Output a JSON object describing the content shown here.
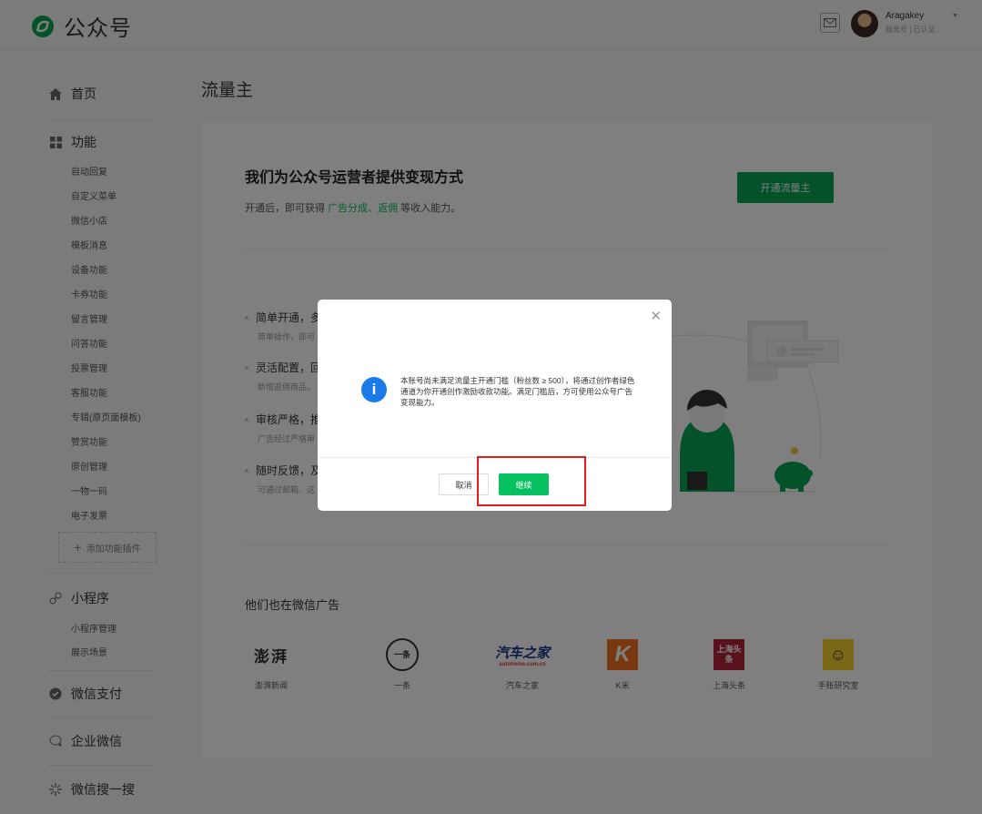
{
  "header": {
    "logo_text": "公众号",
    "user_name": "Aragakey",
    "user_sub": "服务号 | 已认证"
  },
  "sidebar": {
    "home": "首页",
    "features": "功能",
    "feature_items": [
      "自动回复",
      "自定义菜单",
      "微信小店",
      "模板消息",
      "设备功能",
      "卡券功能",
      "留言管理",
      "问答功能",
      "投票管理",
      "客服功能",
      "专辑(原页面模板)",
      "赞赏功能",
      "原创管理",
      "一物一码",
      "电子发票"
    ],
    "add_plugin": "添加功能插件",
    "miniprogram": "小程序",
    "miniprogram_items": [
      "小程序管理",
      "展示场景"
    ],
    "pay": "微信支付",
    "work": "企业微信",
    "search": "微信搜一搜"
  },
  "main": {
    "title": "流量主",
    "hero_title": "我们为公众号运营者提供变现方式",
    "hero_desc_pre": "开通后，即可获得 ",
    "hero_desc_link1": "广告分成",
    "hero_desc_sep": "、",
    "hero_desc_link2": "返佣",
    "hero_desc_post": " 等收入能力。",
    "open_button": "开通流量主",
    "features": [
      {
        "title": "简单开通，多",
        "desc": "简单操作，即可"
      },
      {
        "title": "灵活配置，回",
        "desc": "新增返佣商品，"
      },
      {
        "title": "审核严格，推",
        "desc": "广告经过严格审"
      },
      {
        "title": "随时反馈，及",
        "desc": "可通过邮箱、这"
      }
    ],
    "partners_title": "他们也在微信广告",
    "partners": [
      {
        "name": "澎湃新闻",
        "logo": "澎湃"
      },
      {
        "name": "一条",
        "logo": "一条"
      },
      {
        "name": "汽车之家",
        "logo": "汽车之家",
        "logo_sub": "autohome.com.cn"
      },
      {
        "name": "K米",
        "logo": "K"
      },
      {
        "name": "上海头条",
        "logo": "上海头条"
      },
      {
        "name": "手账研究室",
        "logo": "☺"
      }
    ]
  },
  "modal": {
    "message": "本账号尚未满足流量主开通门槛（粉丝数 ≥ 500），将通过创作者绿色通道为你开通创作激励收款功能。满足门槛后，方可使用公众号广告变现能力。",
    "cancel": "取消",
    "continue": "继续"
  },
  "colors": {
    "brand_green": "#07c160",
    "info_blue": "#1b7ae8",
    "highlight_red": "#e5181e"
  }
}
